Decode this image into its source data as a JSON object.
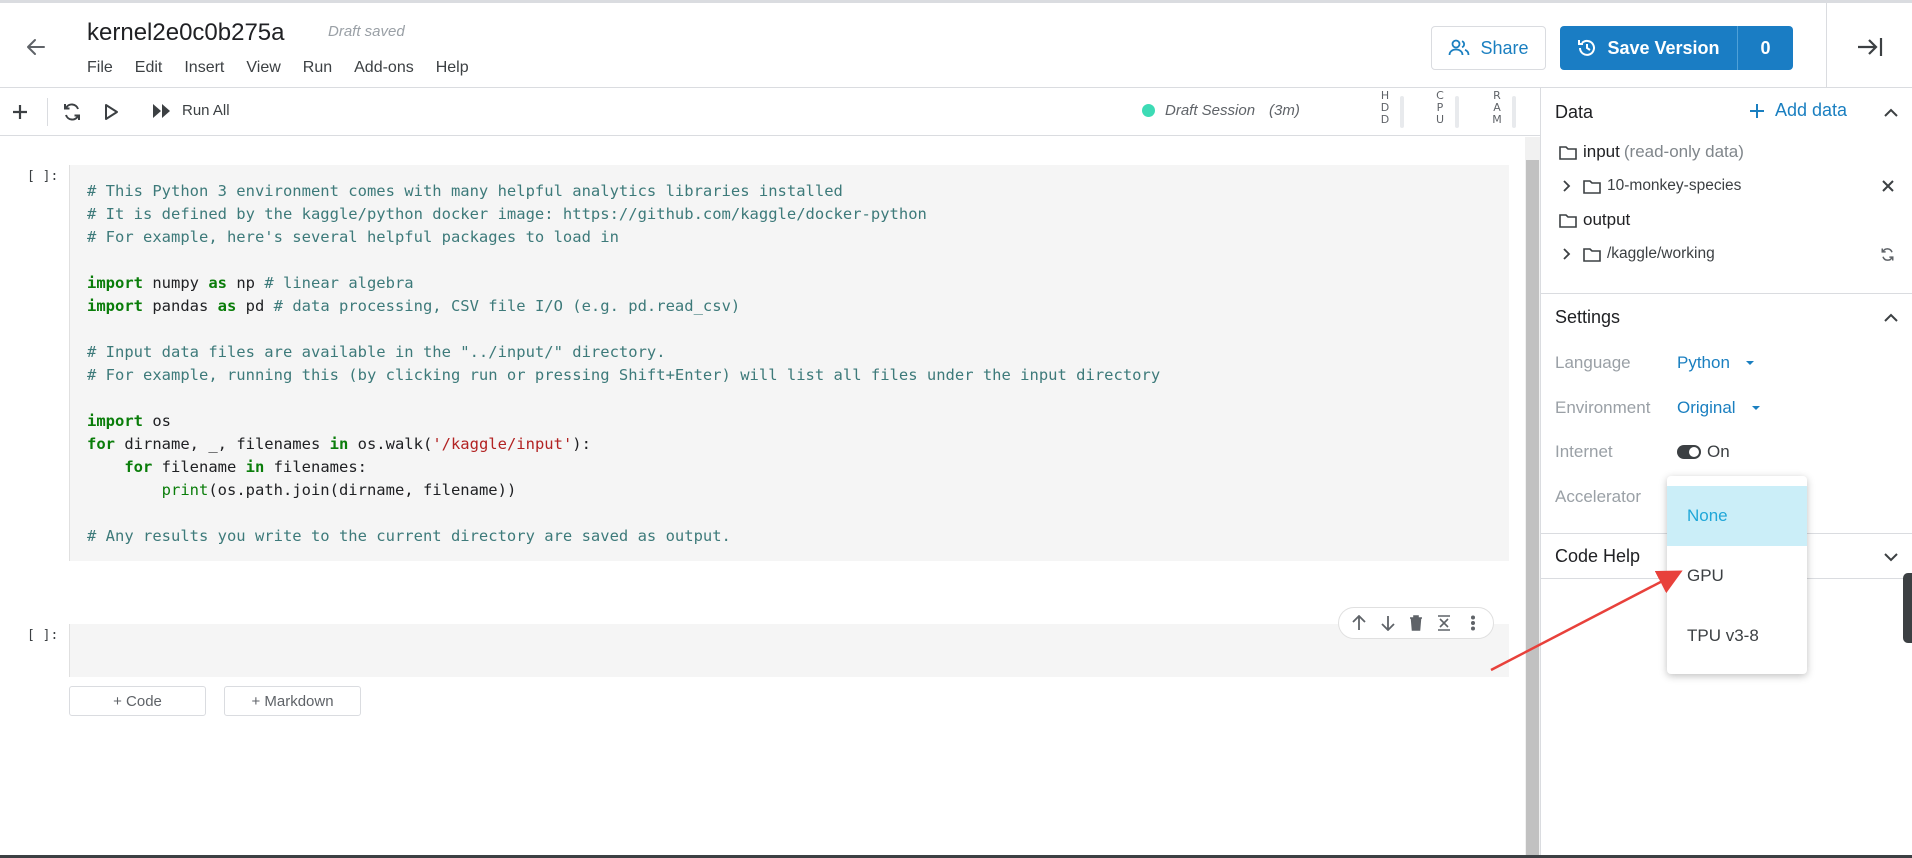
{
  "header": {
    "title": "kernel2e0c0b275a",
    "save_status": "Draft saved",
    "menu": [
      "File",
      "Edit",
      "Insert",
      "View",
      "Run",
      "Add-ons",
      "Help"
    ],
    "share_label": "Share",
    "save_version_label": "Save Version",
    "version_count": "0"
  },
  "toolbar": {
    "run_all_label": "Run All",
    "session_label": "Draft Session",
    "session_time": "(3m)",
    "session_color": "#3ddbb5",
    "meters": [
      "HDD",
      "CPU",
      "RAM"
    ]
  },
  "notebook": {
    "cell1_prompt": "[ ]:",
    "cell2_prompt": "[ ]:",
    "code_lines": [
      "# This Python 3 environment comes with many helpful analytics libraries installed",
      "# It is defined by the kaggle/python docker image: https://github.com/kaggle/docker-python",
      "# For example, here's several helpful packages to load in",
      "",
      "import numpy as np # linear algebra",
      "import pandas as pd # data processing, CSV file I/O (e.g. pd.read_csv)",
      "",
      "# Input data files are available in the \"../input/\" directory.",
      "# For example, running this (by clicking run or pressing Shift+Enter) will list all files under the input directory",
      "",
      "import os",
      "for dirname, _, filenames in os.walk('/kaggle/input'):",
      "    for filename in filenames:",
      "        print(os.path.join(dirname, filename))",
      "",
      "# Any results you write to the current directory are saved as output."
    ],
    "add_code_label": "+ Code",
    "add_markdown_label": "+ Markdown"
  },
  "panel": {
    "data_heading": "Data",
    "add_data_label": "Add data",
    "input_folder": "input",
    "input_note": "(read-only data)",
    "dataset": "10-monkey-species",
    "output_folder": "output",
    "working_dir": "/kaggle/working",
    "settings_heading": "Settings",
    "language_label": "Language",
    "language_value": "Python",
    "environment_label": "Environment",
    "environment_value": "Original",
    "internet_label": "Internet",
    "internet_value": "On",
    "accelerator_label": "Accelerator",
    "code_help_heading": "Code Help"
  },
  "accelerator_dropdown": {
    "options": [
      "None",
      "GPU",
      "TPU v3-8"
    ],
    "selected": "None"
  },
  "colors": {
    "accent": "#1a7fc0",
    "save_button": "#1a7dc4",
    "annotation_arrow": "#e8413b"
  }
}
